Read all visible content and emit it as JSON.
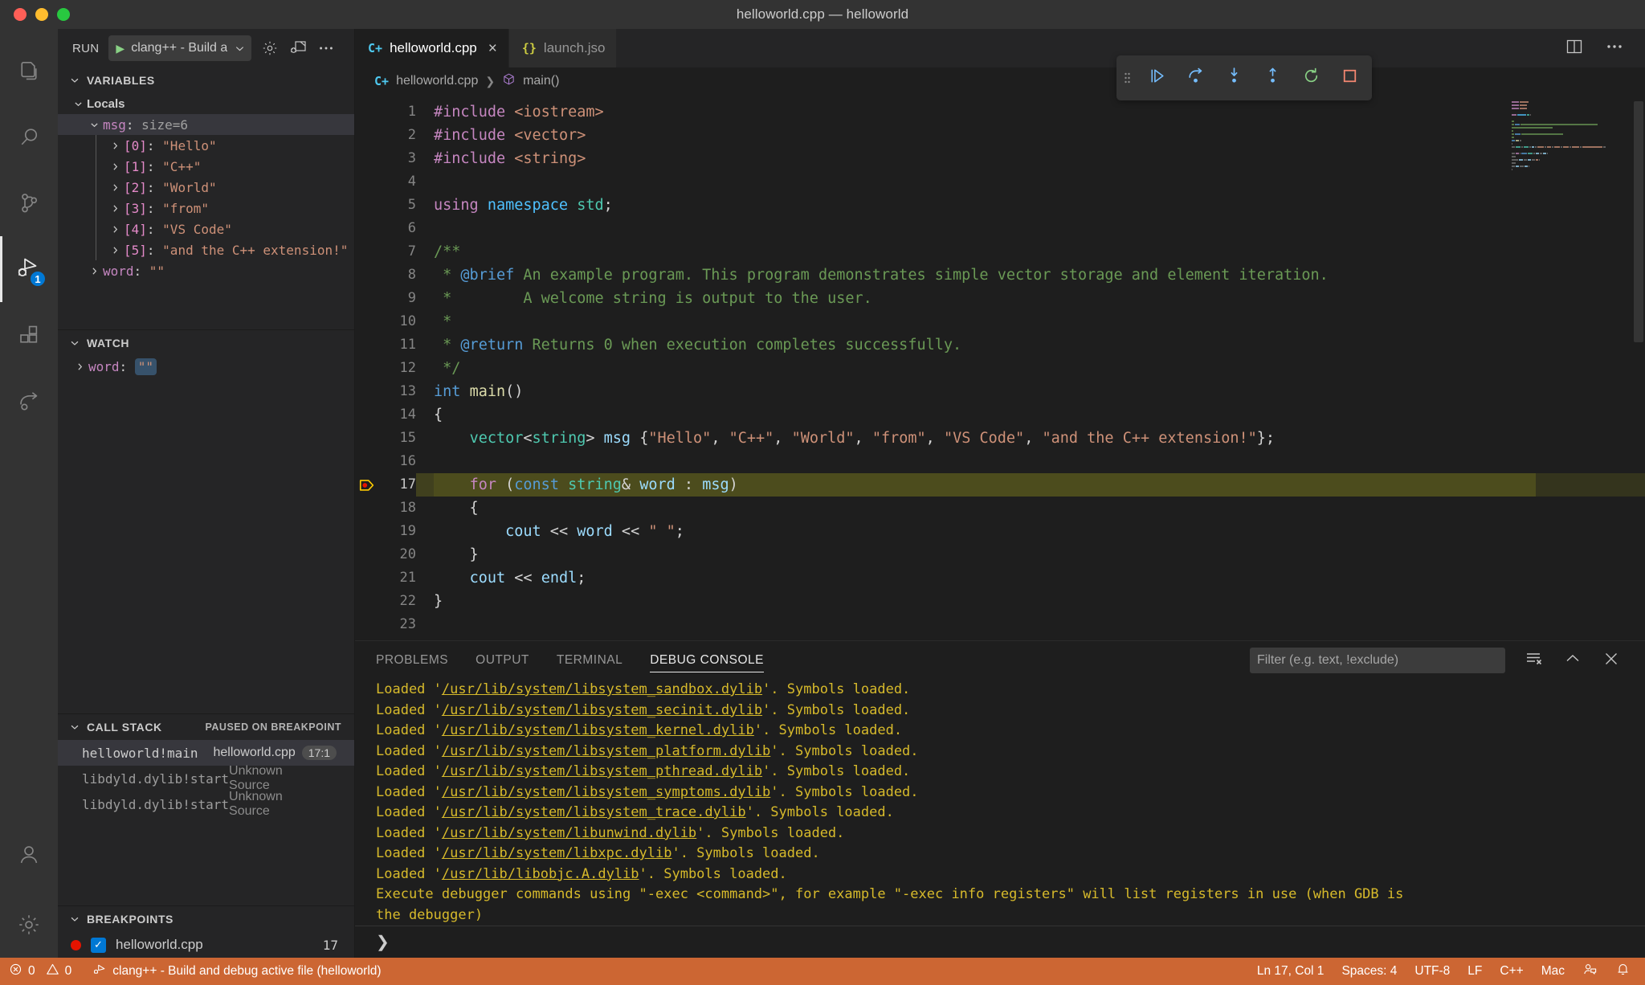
{
  "window": {
    "title": "helloworld.cpp — helloworld"
  },
  "activity_bar": {
    "items": [
      {
        "name": "explorer",
        "icon": "files-icon"
      },
      {
        "name": "search",
        "icon": "search-icon"
      },
      {
        "name": "source-control",
        "icon": "source-control-icon"
      },
      {
        "name": "run-and-debug",
        "icon": "run-debug-icon",
        "badge": "1",
        "active": true
      },
      {
        "name": "extensions",
        "icon": "extensions-icon"
      },
      {
        "name": "remote-explorer",
        "icon": "remote-icon"
      }
    ],
    "bottom": [
      {
        "name": "accounts",
        "icon": "account-icon"
      },
      {
        "name": "manage",
        "icon": "gear-icon"
      }
    ]
  },
  "sidebar": {
    "run_label": "RUN",
    "run_config": "clang++ - Build a",
    "sections": {
      "variables": {
        "title": "VARIABLES",
        "scope": "Locals",
        "root": {
          "name": "msg",
          "value": "size=6"
        },
        "children": [
          {
            "name": "[0]",
            "value": "\"Hello\""
          },
          {
            "name": "[1]",
            "value": "\"C++\""
          },
          {
            "name": "[2]",
            "value": "\"World\""
          },
          {
            "name": "[3]",
            "value": "\"from\""
          },
          {
            "name": "[4]",
            "value": "\"VS Code\""
          },
          {
            "name": "[5]",
            "value": "\"and the C++ extension!\""
          }
        ],
        "word": {
          "name": "word",
          "value": "\"\""
        }
      },
      "watch": {
        "title": "WATCH",
        "items": [
          {
            "name": "word",
            "value": "\"\""
          }
        ]
      },
      "call_stack": {
        "title": "CALL STACK",
        "status": "PAUSED ON BREAKPOINT",
        "frames": [
          {
            "name": "helloworld!main",
            "source": "helloworld.cpp",
            "line": "17:1",
            "selected": true
          },
          {
            "name": "libdyld.dylib!start",
            "source": "Unknown Source",
            "line": ""
          },
          {
            "name": "libdyld.dylib!start",
            "source": "Unknown Source",
            "line": ""
          }
        ]
      },
      "breakpoints": {
        "title": "BREAKPOINTS",
        "items": [
          {
            "label": "helloworld.cpp",
            "line": "17",
            "checked": true
          }
        ]
      }
    }
  },
  "tabs": [
    {
      "label": "helloworld.cpp",
      "icon": "cpp-file-icon",
      "active": true,
      "closable": true
    },
    {
      "label": "launch.jso",
      "icon": "json-file-icon",
      "active": false,
      "closable": false
    }
  ],
  "editor_actions": [
    {
      "name": "split-editor",
      "icon": "split-editor-icon"
    },
    {
      "name": "more-actions",
      "icon": "ellipsis-icon"
    }
  ],
  "debug_toolbar": {
    "buttons": [
      {
        "name": "continue",
        "icon": "continue-icon",
        "color": "#75beff"
      },
      {
        "name": "step-over",
        "icon": "step-over-icon",
        "color": "#75beff"
      },
      {
        "name": "step-into",
        "icon": "step-into-icon",
        "color": "#75beff"
      },
      {
        "name": "step-out",
        "icon": "step-out-icon",
        "color": "#75beff"
      },
      {
        "name": "restart",
        "icon": "restart-icon",
        "color": "#89d185"
      },
      {
        "name": "stop",
        "icon": "stop-icon",
        "color": "#f48771"
      }
    ]
  },
  "breadcrumbs": {
    "file": "helloworld.cpp",
    "symbol": "main()"
  },
  "code": {
    "language": "C++",
    "highlighted_line": 17,
    "breakpoint_line": 17,
    "lines": [
      {
        "n": 1,
        "tokens": [
          {
            "t": "#include ",
            "c": "pre"
          },
          {
            "t": "<iostream>",
            "c": "inc"
          }
        ]
      },
      {
        "n": 2,
        "tokens": [
          {
            "t": "#include ",
            "c": "pre"
          },
          {
            "t": "<vector>",
            "c": "inc"
          }
        ]
      },
      {
        "n": 3,
        "tokens": [
          {
            "t": "#include ",
            "c": "pre"
          },
          {
            "t": "<string>",
            "c": "inc"
          }
        ]
      },
      {
        "n": 4,
        "tokens": []
      },
      {
        "n": 5,
        "tokens": [
          {
            "t": "using ",
            "c": "kw"
          },
          {
            "t": "namespace ",
            "c": "ns2"
          },
          {
            "t": "std",
            "c": "ns"
          },
          {
            "t": ";",
            "c": "op"
          }
        ]
      },
      {
        "n": 6,
        "tokens": []
      },
      {
        "n": 7,
        "tokens": [
          {
            "t": "/**",
            "c": "cmt"
          }
        ]
      },
      {
        "n": 8,
        "tokens": [
          {
            "t": " * ",
            "c": "cmt"
          },
          {
            "t": "@brief",
            "c": "doc"
          },
          {
            "t": " An example program. This program demonstrates simple vector storage and element iteration.",
            "c": "cmt"
          }
        ]
      },
      {
        "n": 9,
        "tokens": [
          {
            "t": " *        A welcome string is output to the user.",
            "c": "cmt"
          }
        ]
      },
      {
        "n": 10,
        "tokens": [
          {
            "t": " *",
            "c": "cmt"
          }
        ]
      },
      {
        "n": 11,
        "tokens": [
          {
            "t": " * ",
            "c": "cmt"
          },
          {
            "t": "@return",
            "c": "doc"
          },
          {
            "t": " Returns 0 when execution completes successfully.",
            "c": "cmt"
          }
        ]
      },
      {
        "n": 12,
        "tokens": [
          {
            "t": " */",
            "c": "cmt"
          }
        ]
      },
      {
        "n": 13,
        "tokens": [
          {
            "t": "int ",
            "c": "type"
          },
          {
            "t": "main",
            "c": "fn"
          },
          {
            "t": "()",
            "c": "op"
          }
        ]
      },
      {
        "n": 14,
        "tokens": [
          {
            "t": "{",
            "c": "op"
          }
        ]
      },
      {
        "n": 15,
        "tokens": [
          {
            "t": "    ",
            "c": "txt"
          },
          {
            "t": "vector",
            "c": "ns"
          },
          {
            "t": "<",
            "c": "op"
          },
          {
            "t": "string",
            "c": "ns"
          },
          {
            "t": "> ",
            "c": "op"
          },
          {
            "t": "msg",
            "c": "var"
          },
          {
            "t": " {",
            "c": "op"
          },
          {
            "t": "\"Hello\"",
            "c": "str"
          },
          {
            "t": ", ",
            "c": "op"
          },
          {
            "t": "\"C++\"",
            "c": "str"
          },
          {
            "t": ", ",
            "c": "op"
          },
          {
            "t": "\"World\"",
            "c": "str"
          },
          {
            "t": ", ",
            "c": "op"
          },
          {
            "t": "\"from\"",
            "c": "str"
          },
          {
            "t": ", ",
            "c": "op"
          },
          {
            "t": "\"VS Code\"",
            "c": "str"
          },
          {
            "t": ", ",
            "c": "op"
          },
          {
            "t": "\"and the C++ extension!\"",
            "c": "str"
          },
          {
            "t": "};",
            "c": "op"
          }
        ]
      },
      {
        "n": 16,
        "tokens": []
      },
      {
        "n": 17,
        "tokens": [
          {
            "t": "    ",
            "c": "txt"
          },
          {
            "t": "for ",
            "c": "kw"
          },
          {
            "t": "(",
            "c": "op"
          },
          {
            "t": "const ",
            "c": "type"
          },
          {
            "t": "string",
            "c": "ns"
          },
          {
            "t": "& ",
            "c": "op"
          },
          {
            "t": "word",
            "c": "var"
          },
          {
            "t": " : ",
            "c": "op"
          },
          {
            "t": "msg",
            "c": "var"
          },
          {
            "t": ")",
            "c": "op"
          }
        ]
      },
      {
        "n": 18,
        "tokens": [
          {
            "t": "    {",
            "c": "op"
          }
        ]
      },
      {
        "n": 19,
        "tokens": [
          {
            "t": "        ",
            "c": "txt"
          },
          {
            "t": "cout",
            "c": "var"
          },
          {
            "t": " << ",
            "c": "op"
          },
          {
            "t": "word",
            "c": "var"
          },
          {
            "t": " << ",
            "c": "op"
          },
          {
            "t": "\" \"",
            "c": "str"
          },
          {
            "t": ";",
            "c": "op"
          }
        ]
      },
      {
        "n": 20,
        "tokens": [
          {
            "t": "    }",
            "c": "op"
          }
        ]
      },
      {
        "n": 21,
        "tokens": [
          {
            "t": "    ",
            "c": "txt"
          },
          {
            "t": "cout",
            "c": "var"
          },
          {
            "t": " << ",
            "c": "op"
          },
          {
            "t": "endl",
            "c": "var"
          },
          {
            "t": ";",
            "c": "op"
          }
        ]
      },
      {
        "n": 22,
        "tokens": [
          {
            "t": "}",
            "c": "op"
          }
        ]
      },
      {
        "n": 23,
        "tokens": []
      }
    ]
  },
  "panel": {
    "tabs": [
      {
        "label": "PROBLEMS",
        "active": false
      },
      {
        "label": "OUTPUT",
        "active": false
      },
      {
        "label": "TERMINAL",
        "active": false
      },
      {
        "label": "DEBUG CONSOLE",
        "active": true
      }
    ],
    "filter_placeholder": "Filter (e.g. text, !exclude)",
    "actions": [
      {
        "name": "clear-console",
        "icon": "clear-icon"
      },
      {
        "name": "maximize-panel",
        "icon": "chevron-up-icon"
      },
      {
        "name": "close-panel",
        "icon": "close-icon"
      }
    ],
    "console_lines": [
      {
        "pre": "Loaded '",
        "link": "/usr/lib/system/libsystem_sandbox.dylib",
        "post": "'. Symbols loaded."
      },
      {
        "pre": "Loaded '",
        "link": "/usr/lib/system/libsystem_secinit.dylib",
        "post": "'. Symbols loaded."
      },
      {
        "pre": "Loaded '",
        "link": "/usr/lib/system/libsystem_kernel.dylib",
        "post": "'. Symbols loaded."
      },
      {
        "pre": "Loaded '",
        "link": "/usr/lib/system/libsystem_platform.dylib",
        "post": "'. Symbols loaded."
      },
      {
        "pre": "Loaded '",
        "link": "/usr/lib/system/libsystem_pthread.dylib",
        "post": "'. Symbols loaded."
      },
      {
        "pre": "Loaded '",
        "link": "/usr/lib/system/libsystem_symptoms.dylib",
        "post": "'. Symbols loaded."
      },
      {
        "pre": "Loaded '",
        "link": "/usr/lib/system/libsystem_trace.dylib",
        "post": "'. Symbols loaded."
      },
      {
        "pre": "Loaded '",
        "link": "/usr/lib/system/libunwind.dylib",
        "post": "'. Symbols loaded."
      },
      {
        "pre": "Loaded '",
        "link": "/usr/lib/system/libxpc.dylib",
        "post": "'. Symbols loaded."
      },
      {
        "pre": "Loaded '",
        "link": "/usr/lib/libobjc.A.dylib",
        "post": "'. Symbols loaded."
      },
      {
        "pre": "Execute debugger commands using \"-exec <command>\", for example \"-exec info registers\" will list registers in use (when GDB is",
        "link": "",
        "post": ""
      },
      {
        "pre": "the debugger)",
        "link": "",
        "post": ""
      }
    ],
    "prompt": "❯"
  },
  "statusbar": {
    "background": "#cc6633",
    "errors": "0",
    "warnings": "0",
    "task": "clang++ - Build and debug active file (helloworld)",
    "right": [
      {
        "name": "cursor-position",
        "label": "Ln 17, Col 1"
      },
      {
        "name": "indentation",
        "label": "Spaces: 4"
      },
      {
        "name": "encoding",
        "label": "UTF-8"
      },
      {
        "name": "eol",
        "label": "LF"
      },
      {
        "name": "language-mode",
        "label": "C++"
      },
      {
        "name": "platform",
        "label": "Mac"
      }
    ],
    "icons": [
      {
        "name": "feedback-icon"
      },
      {
        "name": "bell-icon"
      }
    ]
  }
}
